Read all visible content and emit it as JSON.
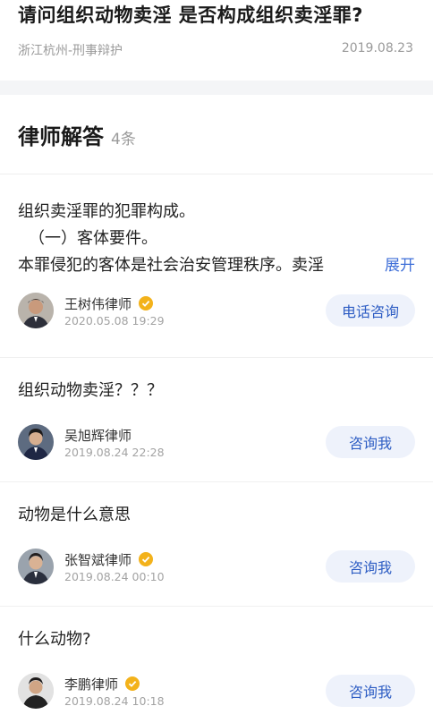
{
  "question": {
    "title": "请问组织动物卖淫 是否构成组织卖淫罪?",
    "category": "浙江杭州-刑事辩护",
    "date": "2019.08.23"
  },
  "answers_section": {
    "title": "律师解答",
    "count": "4条"
  },
  "answers": [
    {
      "lines": [
        "组织卖淫罪的犯罪构成。",
        "（一）客体要件。",
        "本罪侵犯的客体是社会治安管理秩序。卖淫"
      ],
      "expand_label": "展开",
      "lawyer": "王树伟律师",
      "verified": true,
      "date": "2020.05.08 19:29",
      "action": "电话咨询"
    },
    {
      "lines": [
        "组织动物卖淫？？？"
      ],
      "lawyer": "吴旭辉律师",
      "verified": false,
      "date": "2019.08.24 22:28",
      "action": "咨询我"
    },
    {
      "lines": [
        "动物是什么意思"
      ],
      "lawyer": "张智斌律师",
      "verified": true,
      "date": "2019.08.24 00:10",
      "action": "咨询我"
    },
    {
      "lines": [
        "什么动物?"
      ],
      "lawyer": "李鹏律师",
      "verified": true,
      "date": "2019.08.24 10:18",
      "action": "咨询我"
    }
  ],
  "colors": {
    "accent": "#2f5ec4",
    "button_bg": "#eef2fb",
    "verified": "#f3b21b",
    "muted": "#9a9a9a"
  },
  "icons": {
    "verified": "verified-badge-icon",
    "avatar": "lawyer-avatar"
  }
}
